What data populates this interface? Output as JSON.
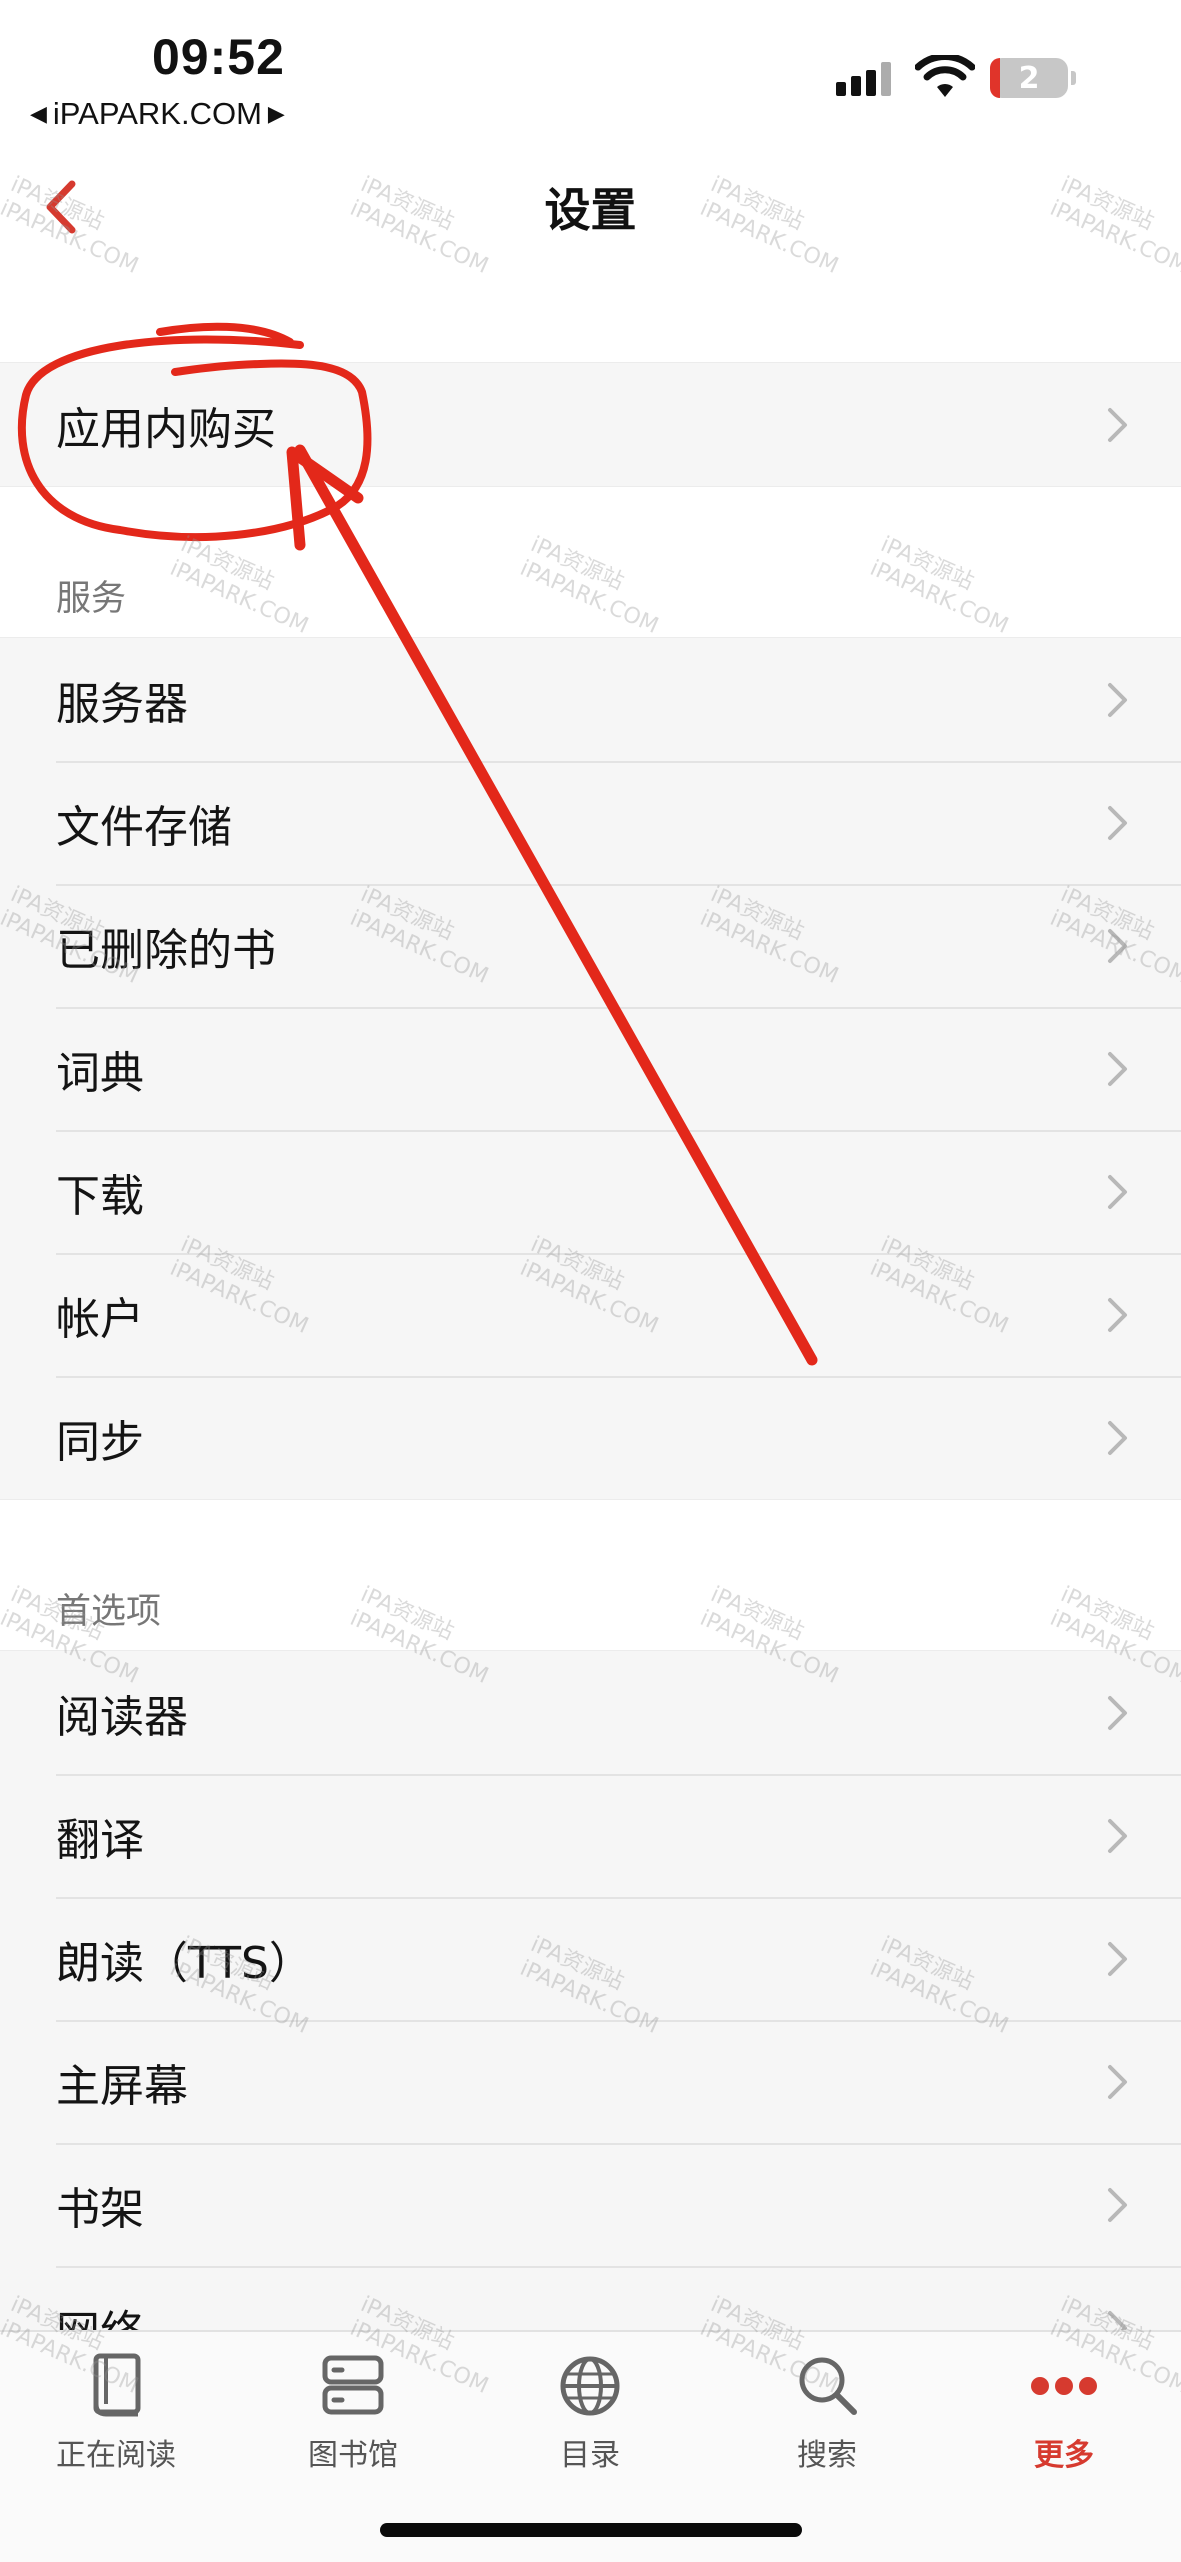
{
  "status_bar": {
    "time": "09:52",
    "carrier": "iPAPARK.COM",
    "battery": "2"
  },
  "nav": {
    "title": "设置",
    "back_icon": "chevron-left-icon"
  },
  "groups": [
    {
      "header": "",
      "items": [
        "应用内购买"
      ]
    },
    {
      "header": "服务",
      "items": [
        "服务器",
        "文件存储",
        "已删除的书",
        "词典",
        "下载",
        "帐户",
        "同步"
      ]
    },
    {
      "header": "首选项",
      "items": [
        "阅读器",
        "翻译",
        "朗读（TTS）",
        "主屏幕",
        "书架",
        "网络"
      ]
    }
  ],
  "tabs": [
    {
      "label": "正在阅读",
      "icon": "book-icon"
    },
    {
      "label": "图书馆",
      "icon": "server-icon"
    },
    {
      "label": "目录",
      "icon": "globe-icon"
    },
    {
      "label": "搜索",
      "icon": "search-icon"
    },
    {
      "label": "更多",
      "icon": "more-dots-icon",
      "active": true
    }
  ],
  "watermark": {
    "line1": "iPA资源站",
    "line2": "iPAPARK.COM"
  },
  "colors": {
    "accent": "#d63a2f",
    "annotation": "#e3281a"
  }
}
